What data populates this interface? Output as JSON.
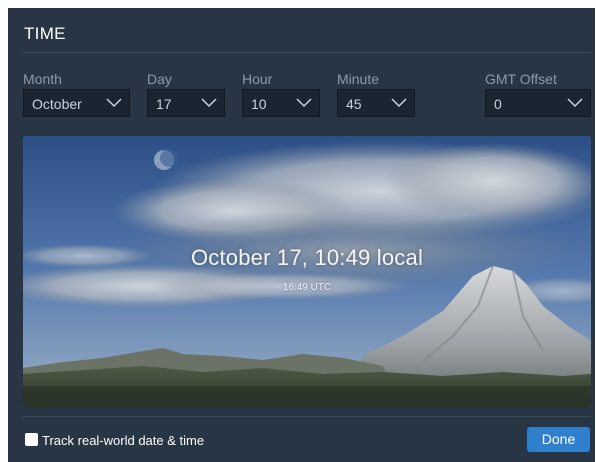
{
  "title": "TIME",
  "fields": {
    "month": {
      "label": "Month",
      "value": "October"
    },
    "day": {
      "label": "Day",
      "value": "17"
    },
    "hour": {
      "label": "Hour",
      "value": "10"
    },
    "minute": {
      "label": "Minute",
      "value": "45"
    },
    "gmt": {
      "label": "GMT Offset",
      "value": "0"
    }
  },
  "preview": {
    "local_time": "October 17, 10:49 local",
    "utc_time": "16:49 UTC"
  },
  "footer": {
    "track_label": "Track real-world date & time",
    "track_checked": false,
    "done_label": "Done"
  },
  "colors": {
    "panel_bg": "#283544",
    "select_bg": "#1b2532",
    "accent": "#2f7fcc"
  }
}
